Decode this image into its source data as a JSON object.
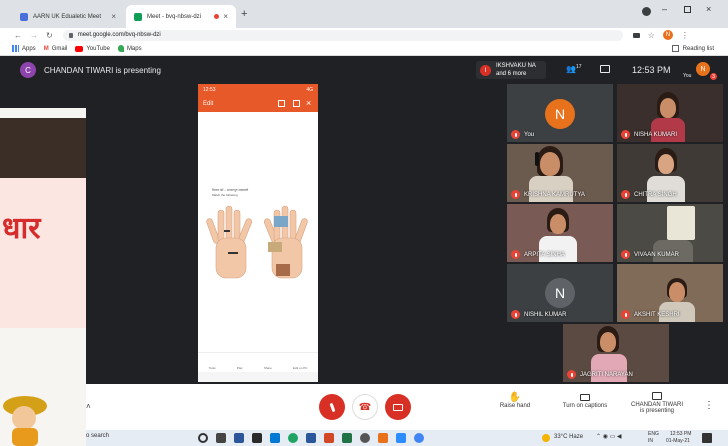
{
  "browser": {
    "tabs": [
      {
        "label": "AARN UK Edualetic Meet",
        "color": "#4a6fd8"
      },
      {
        "label": "Meet - bvq-nbsw-dzi",
        "color": "#0f9d58"
      }
    ],
    "url": "meet.google.com/bvq-nbsw-dzi",
    "bookmarks": [
      "Apps",
      "Gmail",
      "YouTube",
      "Maps"
    ],
    "reading_list": "Reading list",
    "profile_initial": "N"
  },
  "meet": {
    "presenter_initial": "C",
    "presenter_text": "CHANDAN TIWARI is presenting",
    "others_initial": "I",
    "others_name": "IKSHVAKU NA",
    "others_more": "and 6 more",
    "participants_count": "17",
    "time": "12:53 PM",
    "you_label": "You",
    "you_initial": "N",
    "notif_count": "3"
  },
  "slide": {
    "word": "धार"
  },
  "phone": {
    "status_left": "12:53",
    "status_right": "4G",
    "app_title": "Edit",
    "doc_text1": "मिलान करें – आधारभूत शब्दावली",
    "doc_text2": "Match the following",
    "nav": [
      "Tools",
      "Play",
      "Share",
      "Edit on PC"
    ]
  },
  "participants": [
    {
      "name": "You",
      "kind": "avatar",
      "initial": "N",
      "avatar_color": "#e8711c"
    },
    {
      "name": "NISHA KUMARI",
      "kind": "video"
    },
    {
      "name": "KRISHNA KAMRUTYA",
      "kind": "video"
    },
    {
      "name": "CHITRA SINGH",
      "kind": "video"
    },
    {
      "name": "ARPITA SINHA",
      "kind": "video"
    },
    {
      "name": "VIVAAN KUMAR",
      "kind": "video"
    },
    {
      "name": "NISHIL KUMAR",
      "kind": "avatar",
      "initial": "N",
      "avatar_color": "#5f6368"
    },
    {
      "name": "AKSHIT KESHRI",
      "kind": "video"
    },
    {
      "name": "JAGRITI NARAYAN",
      "kind": "video"
    }
  ],
  "controls": {
    "raise_hand": "Raise hand",
    "captions": "Turn on captions",
    "presenting_line1": "CHANDAN TIWARI",
    "presenting_line2": "is presenting"
  },
  "taskbar": {
    "search": "o search",
    "weather": "33°C  Haze",
    "lang1": "ENG",
    "lang2": "IN",
    "clock_time": "12:53 PM",
    "clock_date": "01-May-21"
  },
  "colors": {
    "red": "#ea4335",
    "dark": "#202124",
    "accent": "#e8711c"
  }
}
